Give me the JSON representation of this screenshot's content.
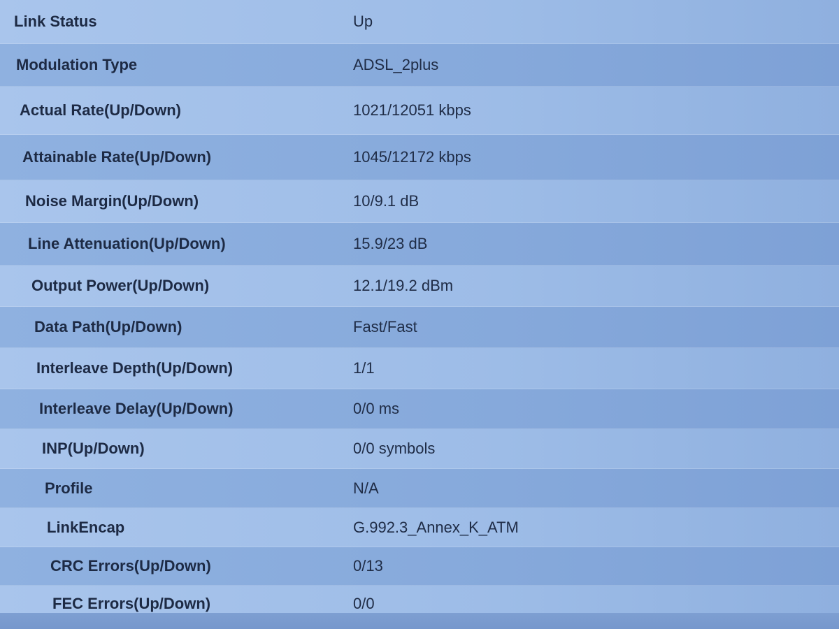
{
  "status_rows": [
    {
      "label": "Link Status",
      "value": "Up"
    },
    {
      "label": "Modulation Type",
      "value": "ADSL_2plus"
    },
    {
      "label": "Actual Rate(Up/Down)",
      "value": "1021/12051 kbps"
    },
    {
      "label": "Attainable Rate(Up/Down)",
      "value": "1045/12172 kbps"
    },
    {
      "label": "Noise Margin(Up/Down)",
      "value": "10/9.1 dB"
    },
    {
      "label": "Line Attenuation(Up/Down)",
      "value": "15.9/23 dB"
    },
    {
      "label": "Output Power(Up/Down)",
      "value": "12.1/19.2 dBm"
    },
    {
      "label": "Data Path(Up/Down)",
      "value": "Fast/Fast"
    },
    {
      "label": "Interleave Depth(Up/Down)",
      "value": "1/1"
    },
    {
      "label": "Interleave Delay(Up/Down)",
      "value": "0/0 ms"
    },
    {
      "label": "INP(Up/Down)",
      "value": "0/0 symbols"
    },
    {
      "label": "Profile",
      "value": "N/A"
    },
    {
      "label": "LinkEncap",
      "value": "G.992.3_Annex_K_ATM"
    },
    {
      "label": "CRC Errors(Up/Down)",
      "value": "0/13"
    },
    {
      "label": "FEC Errors(Up/Down)",
      "value": "0/0"
    }
  ]
}
